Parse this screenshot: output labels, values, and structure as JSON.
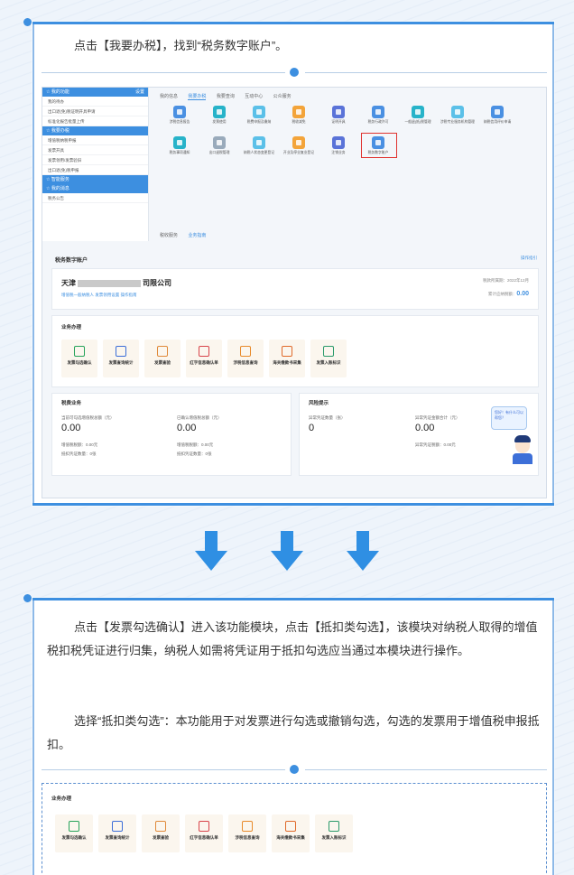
{
  "step1": {
    "text": "点击【我要办税】，找到“税务数字账户”。"
  },
  "screenshot1": {
    "sidebar": {
      "header1": "☆ 我的功能",
      "header1_right": "设置",
      "items1": [
        "我的待办",
        "出口退(免)税证明开具申请",
        "标准化报告批量上传"
      ],
      "header2": "☆ 我要办税",
      "items2": [
        "增值税纳税申报",
        "发票开具",
        "发票领用/发票验旧",
        "出口退(免)税申报"
      ],
      "header3": "☆ 智能服务",
      "header4": "☆ 我的消息",
      "items3": [
        "税务公告"
      ]
    },
    "tabs": [
      "我的信息",
      "我要办税",
      "我要查询",
      "互动中心",
      "公众服务"
    ],
    "active_tab_index": 1,
    "icons_row1": [
      "涉税信息报告",
      "发票使用",
      "税费申报及缴纳",
      "税收减免",
      "证明开具",
      "税务行政许可",
      "一般退(抵)税管理",
      "涉税专业服务机构管理",
      "纳税信用评价申请"
    ],
    "icons_row2": [
      "税务事项通知",
      "出口退税管理",
      "纳税人状态变更登记",
      "开业及停业复业登记",
      "注销业务",
      "税务数字账户"
    ],
    "bottom_tabs": [
      "税收服务",
      "业务指南"
    ],
    "account_title": "税务数字账户",
    "account_link": "操作指引",
    "company_name": "天津",
    "company_suffix": "司限公司",
    "company_sub": "增值税一般纳税人   发票领用设置   操作指南",
    "period_label": "税款所属期：2022年12月",
    "amount_label": "累计应纳税额：",
    "amount_value": "0.00",
    "biz_title": "业务办理",
    "biz_items": [
      "发票勾选确认",
      "发票查询统计",
      "发票查验",
      "红字信息确认单",
      "涉税信息查询",
      "海关缴款书采集",
      "发票入账标识"
    ],
    "tax_panel_title": "税费业务",
    "tax_left_label": "当前可勾选增值税总额（元）",
    "tax_left_value": "0.00",
    "tax_left_rows": [
      "增值税税额：0.00元",
      "抵扣凭证数量：0张"
    ],
    "tax_mid_label": "已确认增值税总额（元）",
    "tax_mid_value": "0.00",
    "tax_mid_rows": [
      "增值税税额：0.00元",
      "抵扣凭证数量：0张"
    ],
    "risk_panel_title": "风险提示",
    "risk_left_label": "异常凭证数量（张）",
    "risk_left_value": "0",
    "risk_mid_label": "异常凭证金额合计（元）",
    "risk_mid_value": "0.00",
    "risk_mid_row": "异常凭证税额：0.00元",
    "assistant_text": "您好！有什么可以帮您？"
  },
  "step2": {
    "para1": "点击【发票勾选确认】进入该功能模块，点击【抵扣类勾选】，该模块对纳税人取得的增值税扣税凭证进行归集，纳税人如需将凭证用于抵扣勾选应当通过本模块进行操作。",
    "para2": "选择“抵扣类勾选”：本功能用于对发票进行勾选或撤销勾选，勾选的发票用于增值税申报抵扣。"
  },
  "screenshot2": {
    "title": "业务办理",
    "items": [
      "发票勾选确认",
      "发票查询统计",
      "发票查验",
      "红字信息确认单",
      "涉税信息查询",
      "海关缴款书采集",
      "发票入账标识"
    ]
  },
  "colors": {
    "accent": "#3d8fe0",
    "highlight": "#e0322f",
    "arrow": "#2f8fe3"
  }
}
